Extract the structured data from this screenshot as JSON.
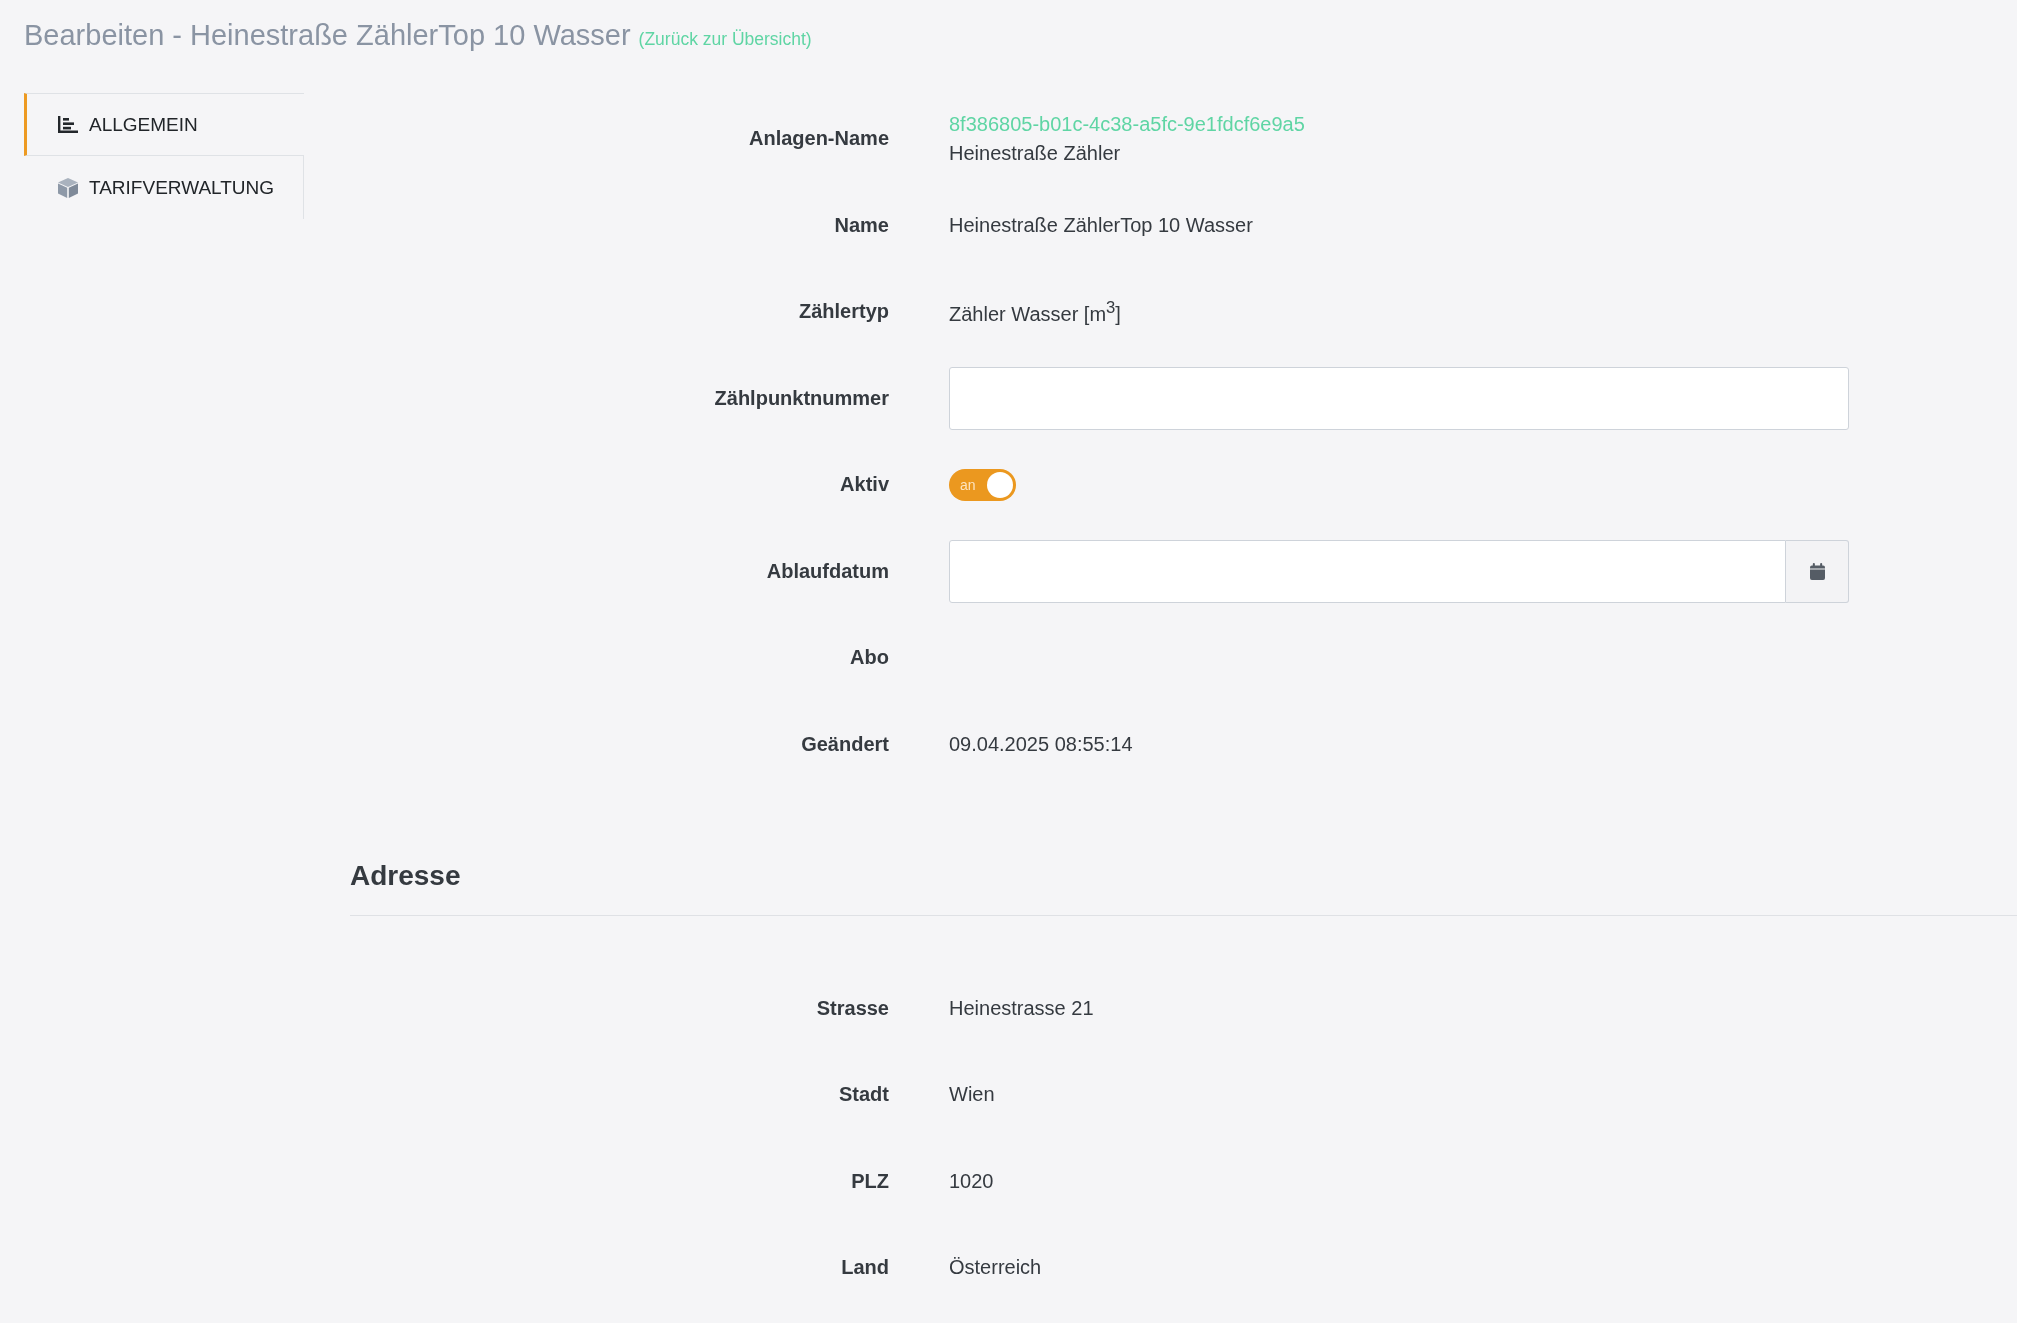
{
  "header": {
    "title": "Bearbeiten - Heinestraße ZählerTop 10 Wasser",
    "back_link": "(Zurück zur Übersicht)"
  },
  "sidebar": {
    "items": [
      {
        "label": "ALLGEMEIN",
        "selected": true
      },
      {
        "label": "TARIFVERWALTUNG",
        "selected": false
      }
    ]
  },
  "form": {
    "fields": [
      {
        "label": "Anlagen-Name",
        "kind": "link_text",
        "link": "8f386805-b01c-4c38-a5fc-9e1fdcf6e9a5",
        "value": "Heinestraße Zähler"
      },
      {
        "label": "Name",
        "kind": "text",
        "value": "Heinestraße ZählerTop 10 Wasser"
      },
      {
        "label": "Zählertyp",
        "kind": "text",
        "value": "Zähler Wasser [m$^{3}$]"
      },
      {
        "label": "Zählpunktnummer",
        "kind": "input"
      },
      {
        "label": "Aktiv",
        "kind": "toggle",
        "on": true,
        "toggle_label": "an"
      },
      {
        "label": "Ablaufdatum",
        "kind": "date"
      },
      {
        "label": "Abo",
        "kind": "blank"
      },
      {
        "label": "Geändert",
        "kind": "text",
        "value": "09.04.2025 08:55:14"
      }
    ]
  },
  "address": {
    "title": "Adresse",
    "fields": [
      {
        "label": "Strasse",
        "kind": "text",
        "value": "Heinestrasse 21"
      },
      {
        "label": "Stadt",
        "kind": "text",
        "value": "Wien"
      },
      {
        "label": "PLZ",
        "kind": "text",
        "value": "1020"
      },
      {
        "label": "Land",
        "kind": "text",
        "value": "Österreich"
      }
    ]
  }
}
